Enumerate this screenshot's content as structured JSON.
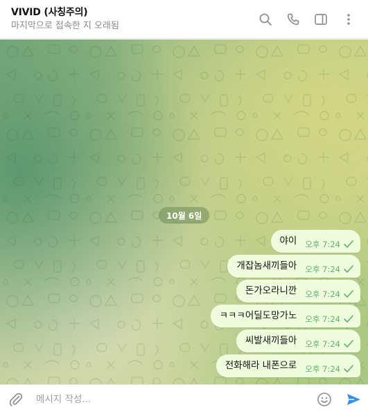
{
  "header": {
    "title": "VIVID (사칭주의)",
    "status": "마지막으로 접속한 지 오래됨",
    "icons": [
      "search-icon",
      "phone-icon",
      "sidebar-toggle-icon",
      "more-vertical-icon"
    ]
  },
  "chat": {
    "date_separator": "10월 6일",
    "messages": [
      {
        "text": "야이",
        "time": "오후 7:24",
        "status": "read"
      },
      {
        "text": "개잡놈새끼들아",
        "time": "오후 7:24",
        "status": "read"
      },
      {
        "text": "돈가오라니깐",
        "time": "오후 7:24",
        "status": "read"
      },
      {
        "text": "ㅋㅋㅋ어딜도망가노",
        "time": "오후 7:24",
        "status": "read"
      },
      {
        "text": "씨발새끼들아",
        "time": "오후 7:24",
        "status": "read"
      },
      {
        "text": "전화해라 내폰으로",
        "time": "오후 7:24",
        "status": "read"
      }
    ]
  },
  "composer": {
    "placeholder": "메시지 작성...",
    "value": ""
  },
  "colors": {
    "outgoing_bubble": "#effdde",
    "time_text": "#5fb16a",
    "send_accent": "#3390ec"
  }
}
